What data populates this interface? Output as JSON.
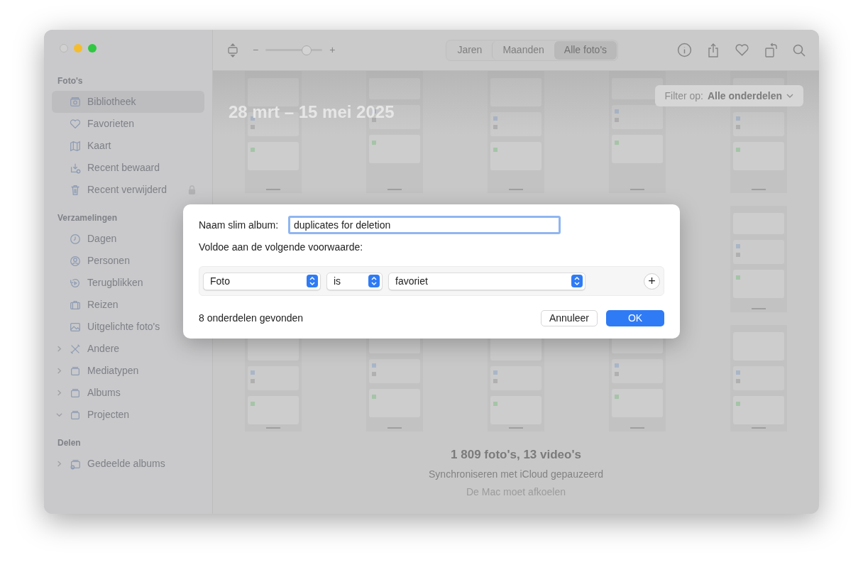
{
  "sidebar": {
    "sections": [
      {
        "title": "Foto's",
        "items": [
          {
            "label": "Bibliotheek",
            "selected": true
          },
          {
            "label": "Favorieten",
            "selected": false
          },
          {
            "label": "Kaart",
            "selected": false
          },
          {
            "label": "Recent bewaard",
            "selected": false
          },
          {
            "label": "Recent verwijderd",
            "selected": false,
            "locked": true
          }
        ]
      },
      {
        "title": "Verzamelingen",
        "items": [
          {
            "label": "Dagen",
            "selected": false
          },
          {
            "label": "Personen",
            "selected": false
          },
          {
            "label": "Terugblikken",
            "selected": false
          },
          {
            "label": "Reizen",
            "selected": false
          },
          {
            "label": "Uitgelichte foto's",
            "selected": false
          },
          {
            "label": "Andere",
            "selected": false,
            "expanded": false
          },
          {
            "label": "Mediatypen",
            "selected": false,
            "expanded": false
          },
          {
            "label": "Albums",
            "selected": false,
            "expanded": false
          },
          {
            "label": "Projecten",
            "selected": false,
            "expanded": true
          }
        ]
      },
      {
        "title": "Delen",
        "items": [
          {
            "label": "Gedeelde albums",
            "selected": false,
            "expanded": false
          }
        ]
      }
    ]
  },
  "toolbar": {
    "zoom": {
      "minus": "−",
      "plus": "+",
      "level": 0.72
    },
    "tabs": [
      {
        "label": "Jaren",
        "selected": false
      },
      {
        "label": "Maanden",
        "selected": false
      },
      {
        "label": "Alle foto's",
        "selected": true
      }
    ]
  },
  "library": {
    "date_range": "28 mrt – 15 mei 2025",
    "filter": {
      "label": "Filter op:",
      "value": "Alle onderdelen"
    },
    "count": "1 809 foto's, 13 video's",
    "sync_status": "Synchroniseren met iCloud gepauzeerd",
    "note": "De Mac moet afkoelen"
  },
  "dialog": {
    "name_label": "Naam slim album:",
    "name_value": "duplicates for deletion",
    "condition_label": "Voldoe aan de volgende voorwaarde:",
    "rule": [
      "Foto",
      "is",
      "favoriet"
    ],
    "add": "+",
    "result": "8 onderdelen gevonden",
    "buttons": [
      {
        "label": "Annuleer",
        "kind": "cancel"
      },
      {
        "label": "OK",
        "kind": "default"
      }
    ]
  }
}
